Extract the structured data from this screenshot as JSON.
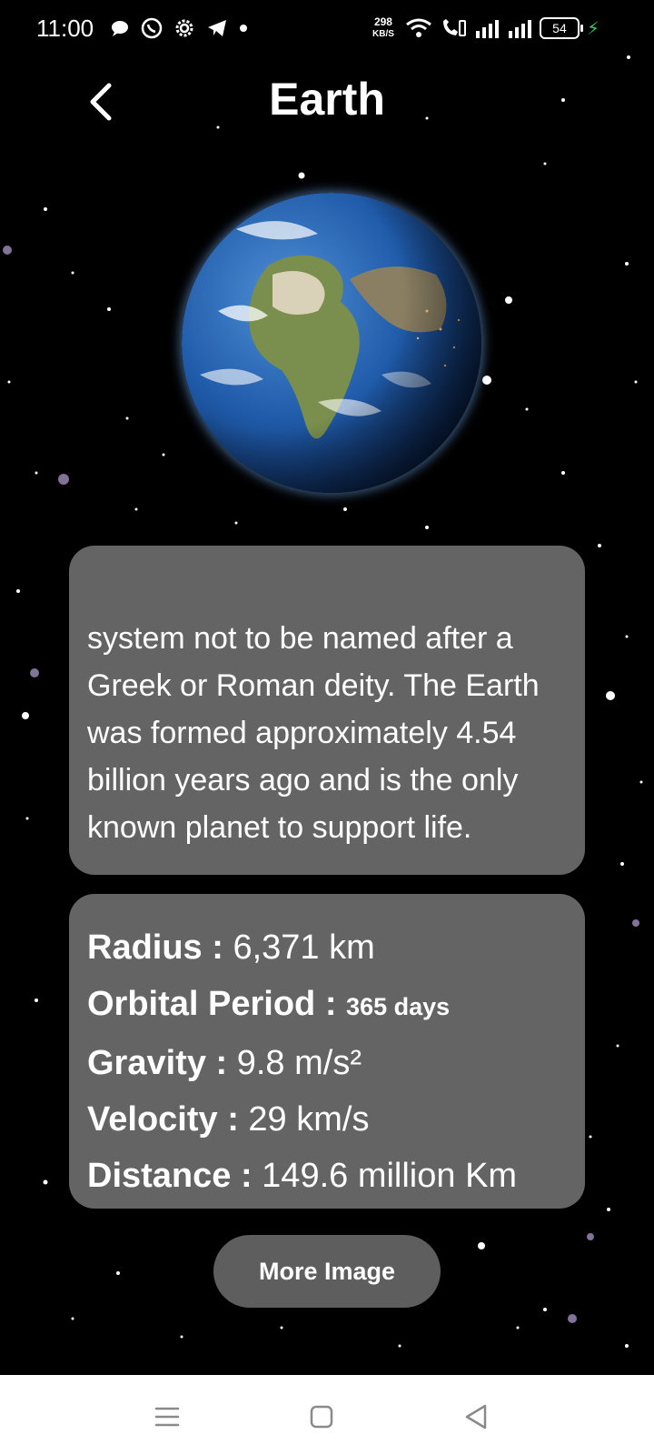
{
  "status_bar": {
    "time": "11:00",
    "net_speed_value": "298",
    "net_speed_unit": "KB/S",
    "battery_level": "54",
    "left_icons": [
      "chat-bubble-icon",
      "whatsapp-icon",
      "settings-gear-icon",
      "telegram-icon",
      "dot-icon"
    ],
    "right_icons": [
      "wifi-icon",
      "wifi-calling-icon",
      "signal-1-icon",
      "signal-2-icon",
      "battery-icon",
      "charging-icon"
    ]
  },
  "header": {
    "title": "Earth",
    "back_icon": "chevron-left-icon"
  },
  "planet": {
    "name": "Earth",
    "image": "earth-globe-image"
  },
  "description": {
    "text": "system not to be named after a Greek or Roman deity. The Earth was formed approximately 4.54 billion years ago and is the only known planet to support life."
  },
  "stats": {
    "radius_label": "Radius : ",
    "radius_value": "6,371 km",
    "orbital_label": "Orbital Period : ",
    "orbital_value": "365 days",
    "gravity_label": "Gravity : ",
    "gravity_value": "9.8 m/s²",
    "velocity_label": "Velocity : ",
    "velocity_value": "29 km/s",
    "distance_label": "Distance : ",
    "distance_value": "149.6 million Km"
  },
  "actions": {
    "more_image_label": "More Image"
  },
  "nav_bar": {
    "icons": [
      "menu-icon",
      "home-square-icon",
      "back-triangle-icon"
    ]
  },
  "colors": {
    "background": "#000000",
    "card": "#646464",
    "button": "#5e5e5e",
    "text": "#ffffff",
    "nav_bar": "#ffffff",
    "charging": "#35c759"
  }
}
